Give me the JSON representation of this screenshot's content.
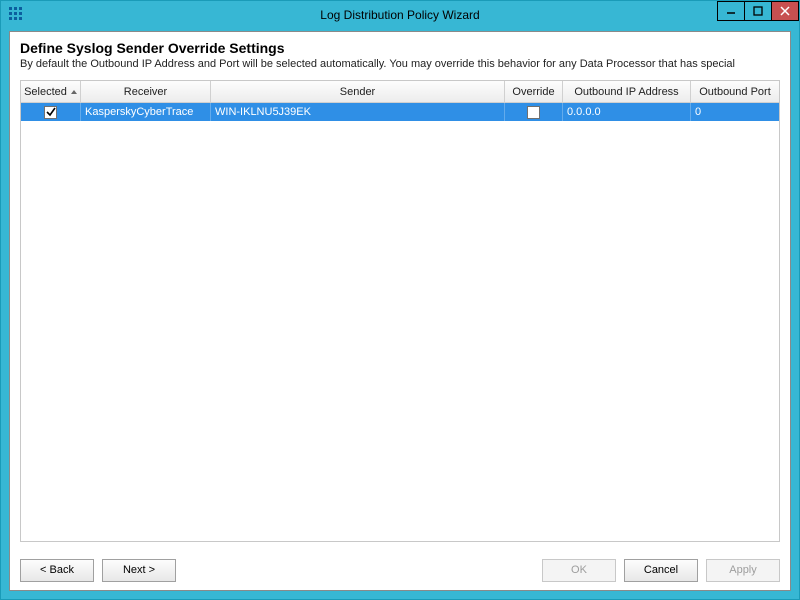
{
  "window": {
    "title": "Log Distribution Policy Wizard"
  },
  "header": {
    "title": "Define Syslog Sender Override Settings",
    "description": "By default the Outbound IP Address and Port will be selected automatically.  You may override this behavior for any Data Processor that has special"
  },
  "grid": {
    "columns": {
      "selected": "Selected",
      "receiver": "Receiver",
      "sender": "Sender",
      "override": "Override",
      "outbound_ip": "Outbound IP Address",
      "outbound_port": "Outbound Port"
    },
    "rows": [
      {
        "selected": true,
        "receiver": "KasperskyCyberTrace",
        "sender": "WIN-IKLNU5J39EK",
        "override": false,
        "outbound_ip": "0.0.0.0",
        "outbound_port": "0"
      }
    ]
  },
  "buttons": {
    "back": "< Back",
    "next": "Next >",
    "ok": "OK",
    "cancel": "Cancel",
    "apply": "Apply"
  }
}
